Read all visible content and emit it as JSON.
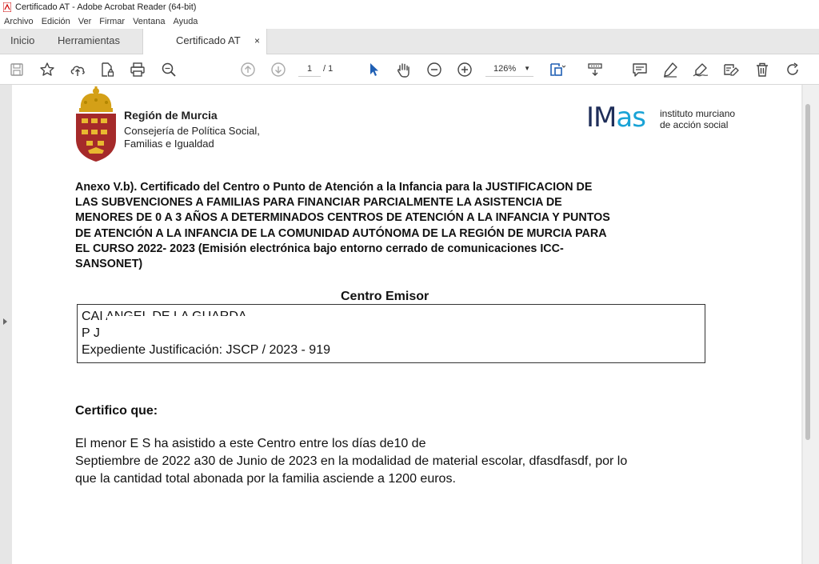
{
  "window": {
    "title": "Certificado AT - Adobe Acrobat Reader (64-bit)"
  },
  "menu": [
    "Archivo",
    "Edición",
    "Ver",
    "Firmar",
    "Ventana",
    "Ayuda"
  ],
  "tabs": {
    "home": "Inicio",
    "tools": "Herramientas",
    "document": "Certificado AT",
    "close": "×"
  },
  "toolbar": {
    "page_current": "1",
    "page_total": "/ 1",
    "zoom": "126%"
  },
  "document": {
    "header": {
      "region_name": "Región de Murcia",
      "region_sub1": "Consejería de Política Social,",
      "region_sub2": "Familias e Igualdad",
      "imas_logo_a": "IM",
      "imas_logo_b": "as",
      "imas_sub1": "instituto murciano",
      "imas_sub2": "de acción social"
    },
    "title_lines": [
      "Anexo V.b). Certificado del Centro o Punto de Atención a la Infancia  para la JUSTIFICACION  DE",
      "LAS SUBVENCIONES A FAMILIAS PARA FINANCIAR PARCIALMENTE LA ASISTENCIA DE",
      "MENORES DE 0 A 3 AÑOS A DETERMINADOS CENTROS DE ATENCIÓN A LA INFANCIA Y PUNTOS",
      "DE ATENCIÓN A LA INFANCIA DE LA COMUNIDAD AUTÓNOMA DE LA REGIÓN DE MURCIA PARA",
      "EL CURSO 2022- 2023 (Emisión electrónica bajo entorno cerrado de comunicaciones ICC-",
      "SANSONET)"
    ],
    "center_title": "Centro Emisor",
    "center_lines": {
      "line1": "CAI ANGEL DE LA GUARDA",
      "line2": "P          J",
      "line3": "Expediente Justificación: JSCP / 2023 - 919"
    },
    "cert_heading": "Certifico que:",
    "cert_lines": [
      "El menor E                                            S ha asistido a este Centro entre los días de10 de",
      "Septiembre de 2022 a30 de Junio de 2023 en la modalidad de material escolar, dfasdfasdf, por lo",
      "que la cantidad total abonada por la familia asciende a 1200 euros."
    ]
  },
  "colors": {
    "accent": "#1f5fb4",
    "imas_dark": "#1f2e59",
    "imas_light": "#1aa3d6",
    "seal_red": "#a52a2a",
    "crown_gold": "#d4a017"
  }
}
